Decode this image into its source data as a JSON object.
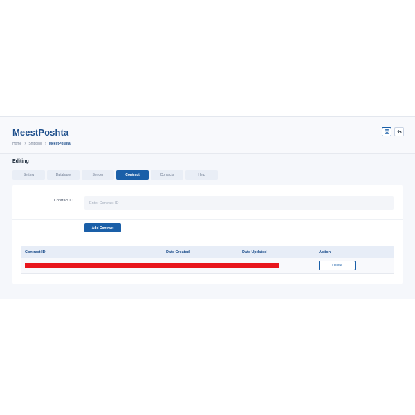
{
  "header": {
    "title": "MeestPoshta",
    "breadcrumb": [
      "Home",
      "Shipping",
      "MeestPoshta"
    ],
    "actions": [
      {
        "icon": "save-icon"
      },
      {
        "icon": "back-arrow-icon"
      }
    ]
  },
  "section_title": "Editing",
  "tabs": [
    {
      "label": "Setting",
      "active": false
    },
    {
      "label": "Database",
      "active": false
    },
    {
      "label": "Sender",
      "active": false
    },
    {
      "label": "Contract",
      "active": true
    },
    {
      "label": "Contacts",
      "active": false
    },
    {
      "label": "Help",
      "active": false
    }
  ],
  "form": {
    "contract_id_label": "Contract ID",
    "contract_id_value": "",
    "contract_id_placeholder": "Enter Contract ID",
    "add_button": "Add Contract"
  },
  "table": {
    "columns": [
      "Contract ID",
      "Date Created",
      "Date Updated",
      "Action"
    ],
    "rows": [
      {
        "contract_id": "",
        "redacted": true,
        "date_created": "",
        "date_updated": "",
        "action": "Delete"
      }
    ]
  },
  "colors": {
    "accent": "#1a5fa8",
    "title": "#1e4f8c",
    "redaction": "#e8161d"
  }
}
